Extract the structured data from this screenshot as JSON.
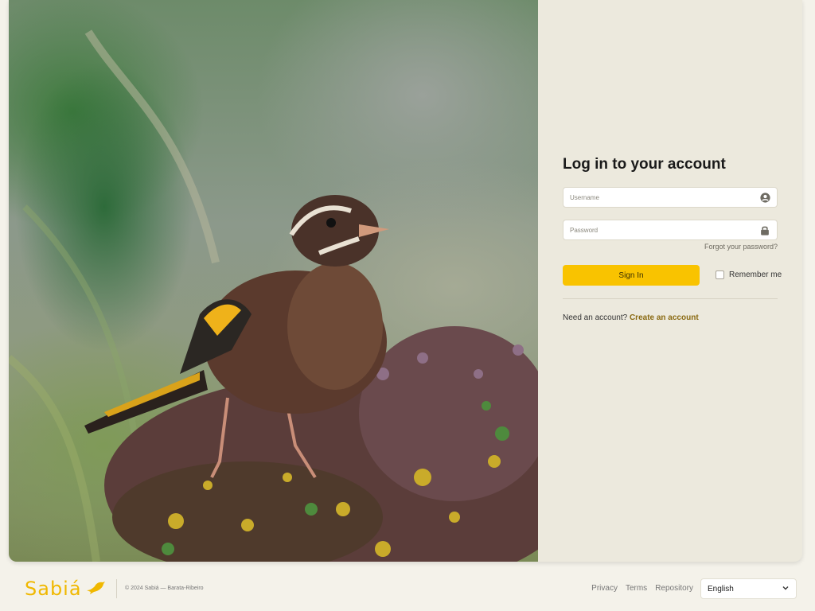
{
  "login": {
    "title": "Log in to your account",
    "username_placeholder": "Username",
    "password_placeholder": "Password",
    "forgot_label": "Forgot your password?",
    "signin_label": "Sign In",
    "remember_label": "Remember me",
    "remember_checked": false,
    "need_account_text": "Need an account?",
    "create_account_label": "Create an account"
  },
  "footer": {
    "brand": "Sabiá",
    "copyright": "© 2024 Sabiá — Barata-Ribeiro",
    "links": [
      "Privacy",
      "Terms",
      "Repository"
    ],
    "language_selected": "English"
  },
  "colors": {
    "accent": "#f9c300",
    "brand": "#f0b800",
    "link": "#8a6a12",
    "panel_bg": "#ece9dd",
    "page_bg": "#f4f2ea"
  },
  "icons": {
    "username": "user-circle-icon",
    "password": "lock-icon",
    "language": "chevron-down-icon",
    "brand": "bird-icon"
  }
}
